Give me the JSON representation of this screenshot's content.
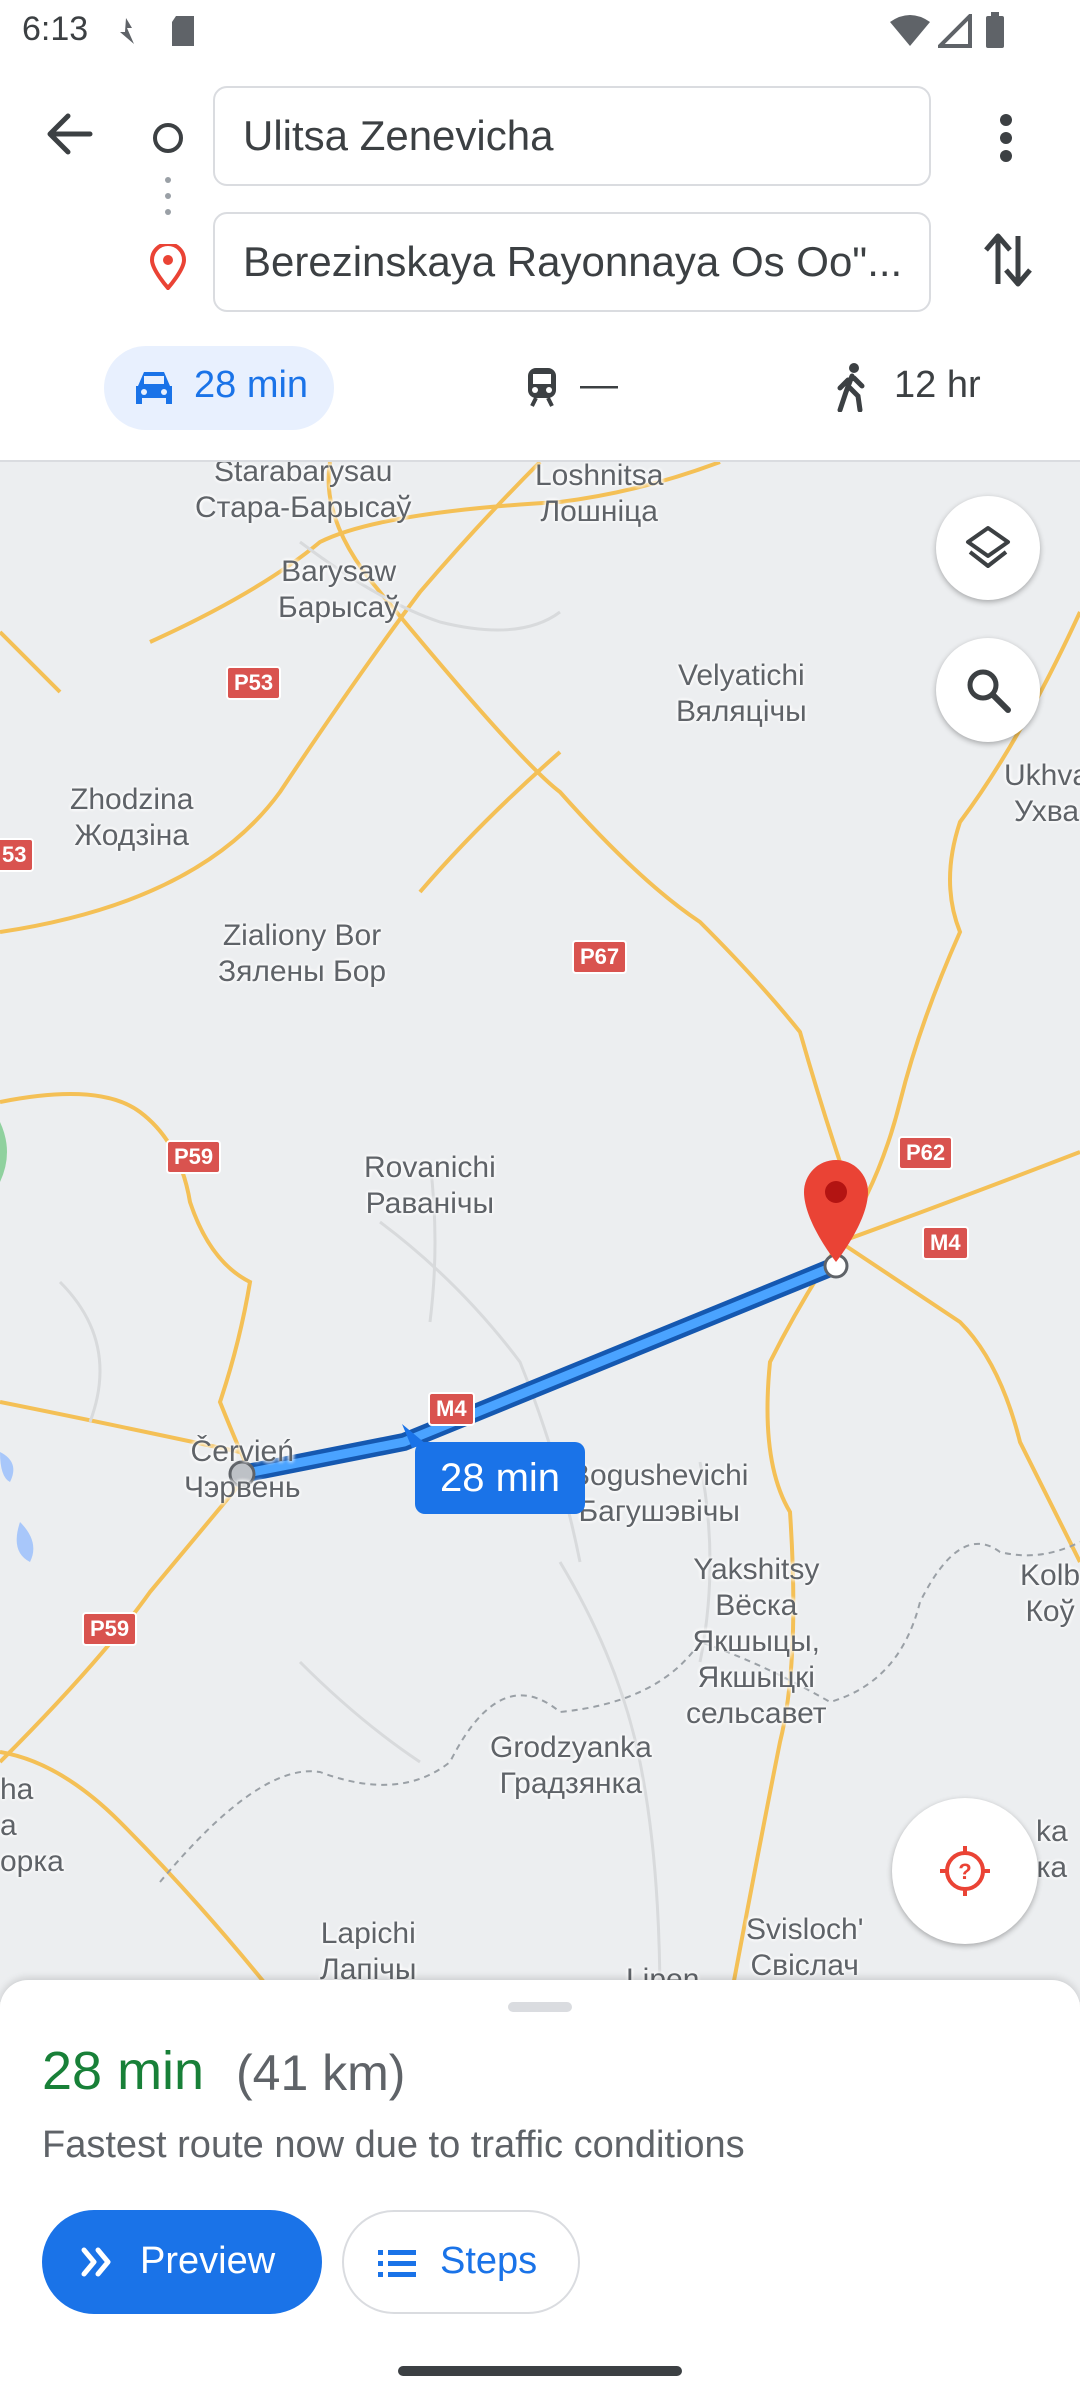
{
  "status_bar": {
    "time": "6:13"
  },
  "directions": {
    "origin": "Ulitsa Zenevicha",
    "destination": "Berezinskaya Rayonnaya Os Oo\"..."
  },
  "modes": {
    "drive": "28 min",
    "transit": "—",
    "walk": "12 hr"
  },
  "map": {
    "route_label": "28 min",
    "places": [
      {
        "text": "Starabarysau\nСтара-Барысаў"
      },
      {
        "text": "Loshnitsa\nЛошніца"
      },
      {
        "text": "Barysaw\nБарысаў"
      },
      {
        "text": "Velyatichi\nВяляцічы"
      },
      {
        "text": "Zhodzina\nЖодзіна"
      },
      {
        "text": "Ukhva\nУхва"
      },
      {
        "text": "Zialiony Bor\nЗялены Бор"
      },
      {
        "text": "Rovanichi\nРаванічы"
      },
      {
        "text": "Červień\nЧэрвень"
      },
      {
        "text": "Bogushevichi\nБагушэвічы"
      },
      {
        "text": "Yakshitsy\nВёска\nЯкшыцы,\nЯкшыцкі\nсельсавет"
      },
      {
        "text": "Kolb\nКоў"
      },
      {
        "text": "Grodzyanka\nГрадзянка"
      },
      {
        "text": "Lapichi\nЛапічы"
      },
      {
        "text": "Svisloch'\nСвіслач"
      },
      {
        "text": "Lipen"
      },
      {
        "text": "ka\nка"
      },
      {
        "text": "ha\nа\nорка"
      }
    ],
    "shields": [
      "P53",
      "53",
      "P67",
      "P59",
      "P62",
      "M4",
      "M4",
      "P59"
    ]
  },
  "summary": {
    "duration": "28 min",
    "distance": "(41 km)",
    "note": "Fastest route now due to traffic conditions",
    "preview_label": "Preview",
    "steps_label": "Steps"
  },
  "colors": {
    "accent": "#1a73e8",
    "route": "#1a73e8",
    "duration_green": "#188038",
    "pin": "#ea4335"
  }
}
